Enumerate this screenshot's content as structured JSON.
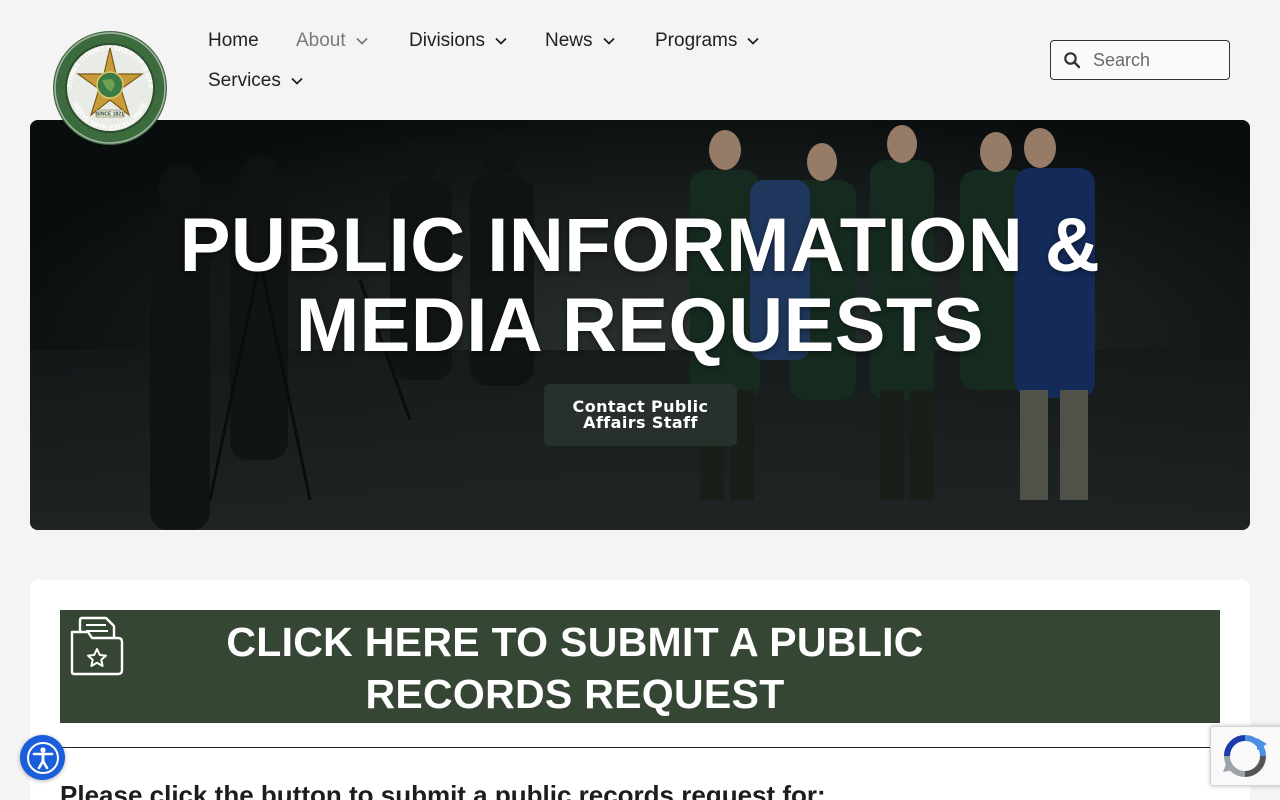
{
  "header": {
    "logo_text_top": "ST. JOHNS COUNTY SHERIFF'S OFFICE",
    "logo_text_since": "SINCE 1821",
    "logo_text_motto": "SERVE WITH EXCELLENCE",
    "nav": {
      "home": "Home",
      "about": "About",
      "divisions": "Divisions",
      "news": "News",
      "programs": "Programs",
      "services": "Services"
    },
    "search_placeholder": "Search"
  },
  "hero": {
    "title_line1": "PUBLIC INFORMATION &",
    "title_line2": "MEDIA REQUESTS",
    "button_line1": "Contact Public",
    "button_line2": "Affairs Staff"
  },
  "content": {
    "cta_line1": "CLICK HERE TO SUBMIT A PUBLIC",
    "cta_line2": "RECORDS REQUEST",
    "subheading": "Please click the button to submit a public records request for:"
  },
  "colors": {
    "brand_green": "#364634",
    "hero_button": "#27302a",
    "accessibility_blue": "#1a5edb",
    "page_background": "#f3f4f3"
  },
  "icons": {
    "search": "search-icon",
    "chevron": "chevron-down-icon",
    "folder": "folder-star-icon",
    "accessibility": "accessibility-icon",
    "recaptcha": "recaptcha-icon"
  }
}
